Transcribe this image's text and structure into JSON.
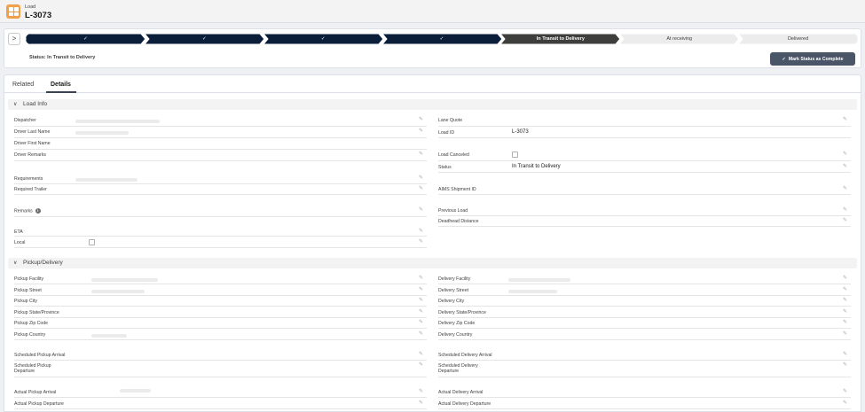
{
  "header": {
    "object_label": "Load",
    "record_title": "L-3073"
  },
  "path": {
    "toggle_glyph": ">",
    "steps": [
      {
        "label": "✓",
        "state": "complete"
      },
      {
        "label": "✓",
        "state": "complete"
      },
      {
        "label": "✓",
        "state": "complete"
      },
      {
        "label": "✓",
        "state": "complete"
      },
      {
        "label": "In Transit to Delivery",
        "state": "current"
      },
      {
        "label": "At receiving",
        "state": "incomplete"
      },
      {
        "label": "Delivered",
        "state": "incomplete"
      }
    ],
    "status_text": "Status: In Transit to Delivery",
    "mark_button": "Mark Status as Complete",
    "colors": {
      "complete": "#0b1f3a",
      "current": "#3e3e3c",
      "incomplete": "#ececec"
    }
  },
  "tabs": [
    {
      "label": "Related",
      "active": false
    },
    {
      "label": "Details",
      "active": true
    }
  ],
  "sections": {
    "load_info": {
      "title": "Load Info",
      "left": {
        "dispatcher": {
          "label": "Dispatcher"
        },
        "driver_last_name": {
          "label": "Driver Last Name"
        },
        "driver_first_name": {
          "label": "Driver First Name"
        },
        "driver_remarks": {
          "label": "Driver Remarks"
        },
        "requirements": {
          "label": "Requirements"
        },
        "required_trailer": {
          "label": "Required Trailer"
        },
        "remarks": {
          "label": "Remarks"
        },
        "eta": {
          "label": "ETA"
        },
        "local": {
          "label": "Local"
        }
      },
      "right": {
        "lane_quote": {
          "label": "Lane Quote"
        },
        "load_id": {
          "label": "Load ID",
          "value": "L-3073"
        },
        "load_canceled": {
          "label": "Load Canceled"
        },
        "status": {
          "label": "Status",
          "value": "In Transit to Delivery"
        },
        "aims_shipment_id": {
          "label": "AIMS Shipment ID"
        },
        "previous_load": {
          "label": "Previous Load"
        },
        "deadhead_distance": {
          "label": "Deadhead Distance"
        }
      }
    },
    "pickup_delivery": {
      "title": "Pickup/Delivery",
      "left": {
        "pickup_facility": {
          "label": "Pickup Facility"
        },
        "pickup_street": {
          "label": "Pickup Street"
        },
        "pickup_city": {
          "label": "Pickup City"
        },
        "pickup_state": {
          "label": "Pickup State/Province"
        },
        "pickup_zip": {
          "label": "Pickup Zip Code"
        },
        "pickup_country": {
          "label": "Pickup Country"
        },
        "scheduled_pickup_arrival": {
          "label": "Scheduled Pickup Arrival"
        },
        "scheduled_pickup_departure_1": {
          "label": "Scheduled Pickup"
        },
        "scheduled_pickup_departure_2": {
          "label": "Departure"
        },
        "actual_pickup_arrival": {
          "label": "Actual Pickup Arrival"
        },
        "actual_pickup_departure": {
          "label": "Actual Pickup Departure"
        }
      },
      "right": {
        "delivery_facility": {
          "label": "Delivery Facility"
        },
        "delivery_street": {
          "label": "Delivery Street"
        },
        "delivery_city": {
          "label": "Delivery City"
        },
        "delivery_state": {
          "label": "Delivery State/Province"
        },
        "delivery_zip": {
          "label": "Delivery Zip Code"
        },
        "delivery_country": {
          "label": "Delivery Country"
        },
        "scheduled_delivery_arrival": {
          "label": "Scheduled Delivery Arrival"
        },
        "scheduled_delivery_departure_1": {
          "label": "Scheduled Delivery"
        },
        "scheduled_delivery_departure_2": {
          "label": "Departure"
        },
        "actual_delivery_arrival": {
          "label": "Actual Delivery Arrival"
        },
        "actual_delivery_departure": {
          "label": "Actual Delivery Departure"
        }
      }
    }
  },
  "icons": {
    "edit": "pencil-icon",
    "chevron": "chevron-down-icon",
    "info": "info-icon",
    "check": "check-icon"
  }
}
